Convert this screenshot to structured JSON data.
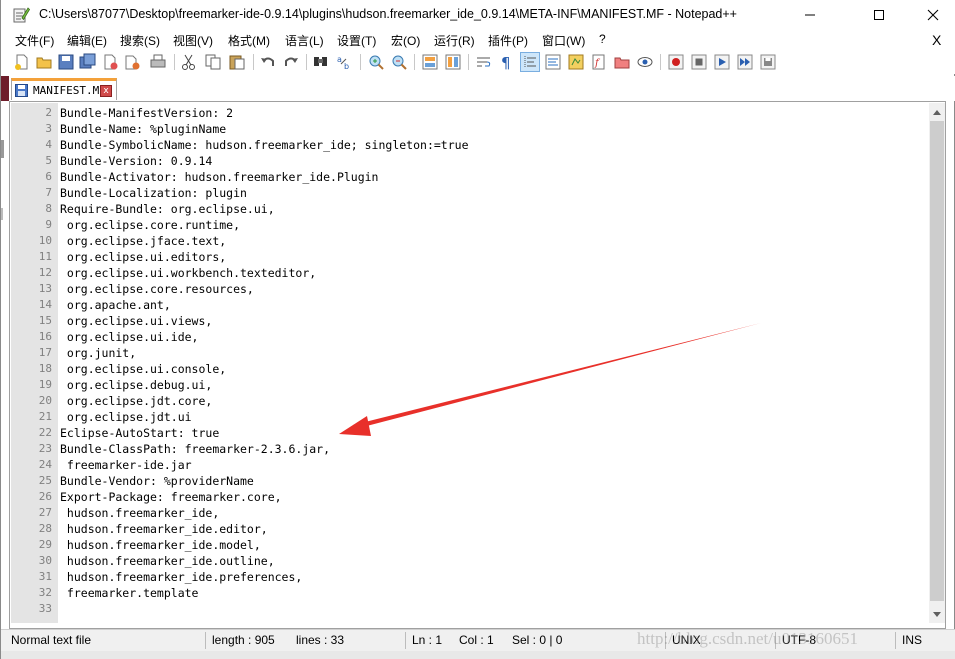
{
  "window": {
    "title": "C:\\Users\\87077\\Desktop\\freemarker-ide-0.9.14\\plugins\\hudson.freemarker_ide_0.9.14\\META-INF\\MANIFEST.MF - Notepad++"
  },
  "menu": {
    "items": [
      "文件(F)",
      "编辑(E)",
      "搜索(S)",
      "视图(V)",
      "格式(M)",
      "语言(L)",
      "设置(T)",
      "宏(O)",
      "运行(R)",
      "插件(P)",
      "窗口(W)",
      "?"
    ],
    "close": "X"
  },
  "tab": {
    "label": "MANIFEST.MF",
    "close": "x"
  },
  "editor": {
    "line_numbers": [
      "2",
      "3",
      "4",
      "5",
      "6",
      "7",
      "8",
      "9",
      "10",
      "11",
      "12",
      "13",
      "14",
      "15",
      "16",
      "17",
      "18",
      "19",
      "20",
      "21",
      "22",
      "23",
      "24",
      "25",
      "26",
      "27",
      "28",
      "29",
      "30",
      "31",
      "32",
      "33"
    ],
    "lines": [
      "Bundle-ManifestVersion: 2",
      "Bundle-Name: %pluginName",
      "Bundle-SymbolicName: hudson.freemarker_ide; singleton:=true",
      "Bundle-Version: 0.9.14",
      "Bundle-Activator: hudson.freemarker_ide.Plugin",
      "Bundle-Localization: plugin",
      "Require-Bundle: org.eclipse.ui,",
      " org.eclipse.core.runtime,",
      " org.eclipse.jface.text,",
      " org.eclipse.ui.editors,",
      " org.eclipse.ui.workbench.texteditor,",
      " org.eclipse.core.resources,",
      " org.apache.ant,",
      " org.eclipse.ui.views,",
      " org.eclipse.ui.ide,",
      " org.junit,",
      " org.eclipse.ui.console,",
      " org.eclipse.debug.ui,",
      " org.eclipse.jdt.core,",
      " org.eclipse.jdt.ui",
      "Eclipse-AutoStart: true",
      "Bundle-ClassPath: freemarker-2.3.6.jar,",
      " freemarker-ide.jar",
      "Bundle-Vendor: %providerName",
      "Export-Package: freemarker.core,",
      " hudson.freemarker_ide,",
      " hudson.freemarker_ide.editor,",
      " hudson.freemarker_ide.model,",
      " hudson.freemarker_ide.outline,",
      " hudson.freemarker_ide.preferences,",
      " freemarker.template",
      ""
    ]
  },
  "status": {
    "filetype": "Normal text file",
    "length": "length : 905",
    "lines": "lines : 33",
    "ln": "Ln : 1",
    "col": "Col : 1",
    "sel": "Sel : 0 | 0",
    "eol": "UNIX",
    "encoding": "UTF-8",
    "mode": "INS"
  },
  "watermark": "http://blog.csdn.net/u013160651",
  "colors": {
    "arrow": "#e8302a",
    "tab_accent": "#f4a13a",
    "gutter_bg": "#e4e4e4"
  }
}
